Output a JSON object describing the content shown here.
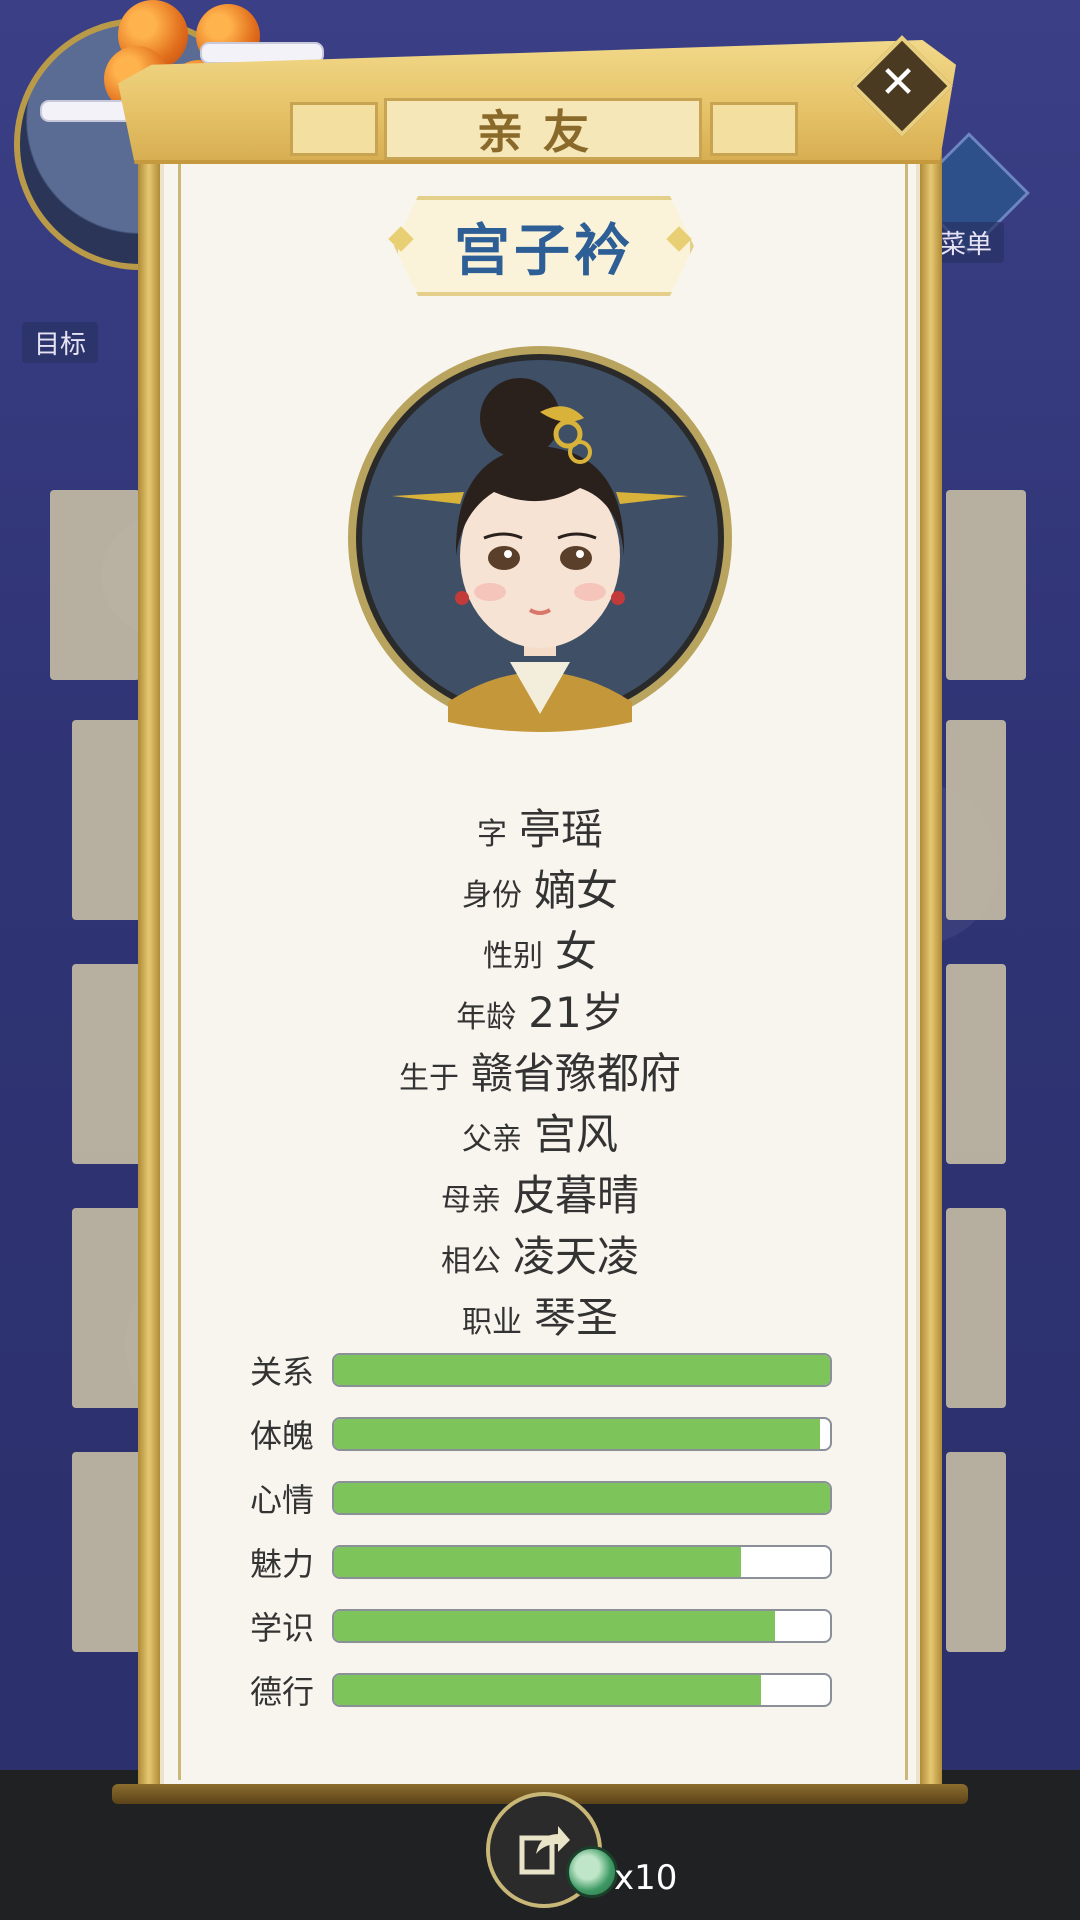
{
  "background": {
    "goal_label": "目标",
    "menu_label": "菜单"
  },
  "dialog": {
    "title": "亲友",
    "close_symbol": "✕",
    "name": "宫子衿",
    "info": [
      {
        "key": "字",
        "value": "亭瑶"
      },
      {
        "key": "身份",
        "value": "嫡女"
      },
      {
        "key": "性别",
        "value": "女"
      },
      {
        "key": "年龄",
        "value": "21岁"
      },
      {
        "key": "生于",
        "value": "赣省豫都府"
      },
      {
        "key": "父亲",
        "value": "宫风"
      },
      {
        "key": "母亲",
        "value": "皮暮晴"
      },
      {
        "key": "相公",
        "value": "凌天凌"
      },
      {
        "key": "职业",
        "value": "琴圣"
      }
    ],
    "stats": [
      {
        "label": "关系",
        "level": 1.0
      },
      {
        "label": "体魄",
        "level": 0.98
      },
      {
        "label": "心情",
        "level": 1.0
      },
      {
        "label": "魅力",
        "level": 0.82
      },
      {
        "label": "学识",
        "level": 0.89
      },
      {
        "label": "德行",
        "level": 0.86
      }
    ],
    "colors": {
      "name_color": "#2d5f96",
      "bar_fill": "#7dc45a"
    }
  },
  "footer": {
    "share_icon": "share-icon",
    "coin_count": "x10"
  }
}
